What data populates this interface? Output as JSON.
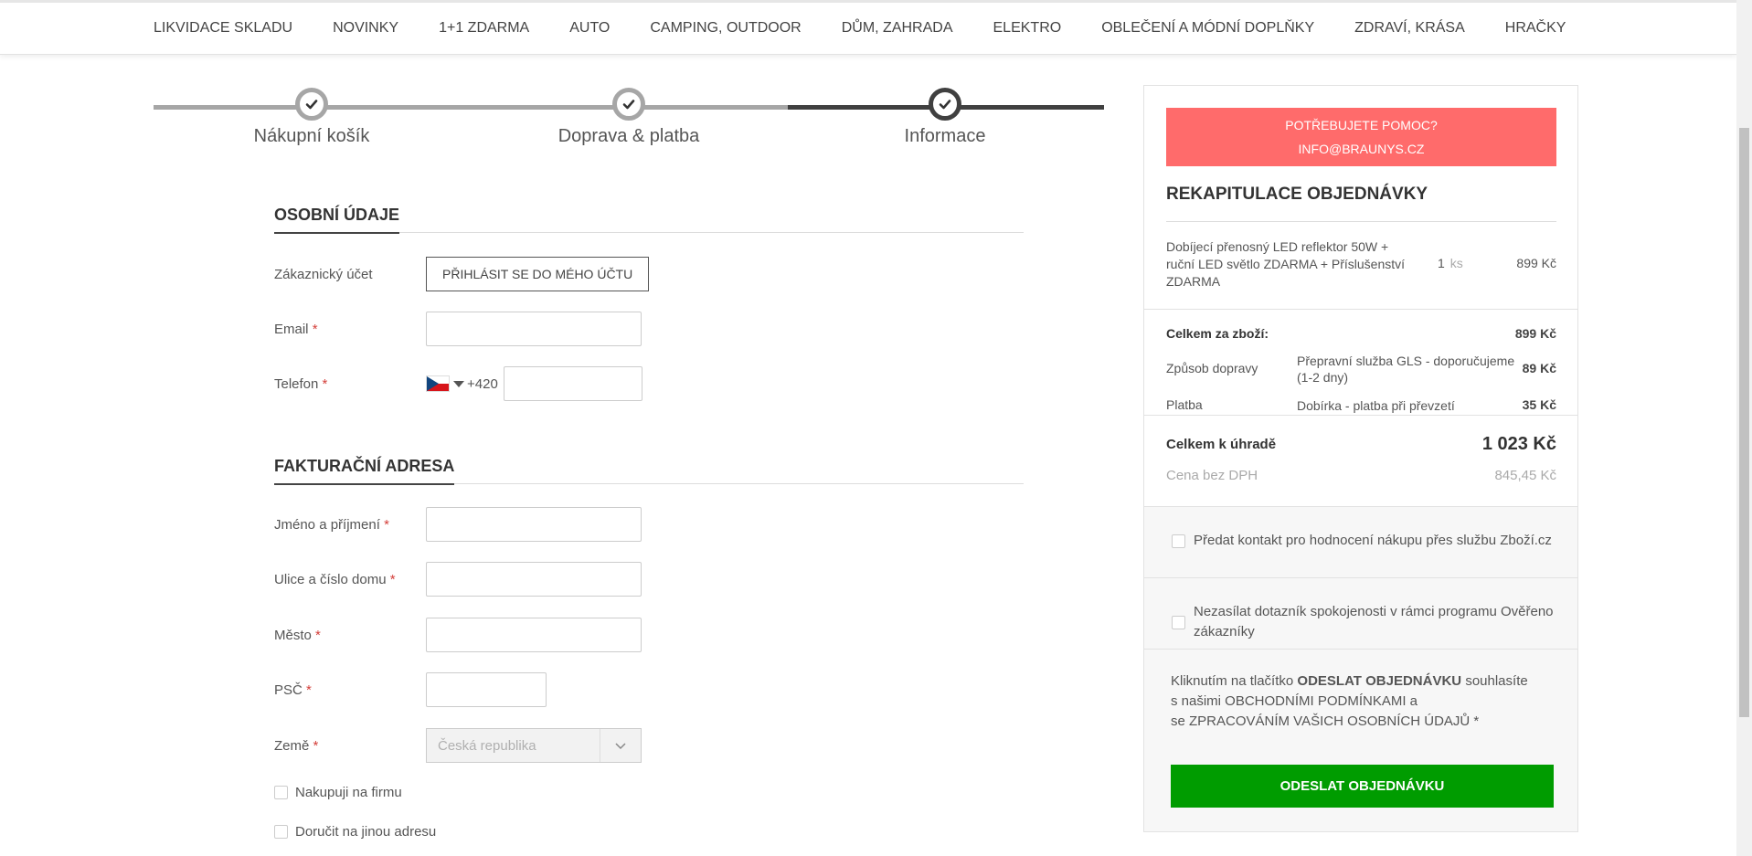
{
  "nav": {
    "items": [
      "LIKVIDACE SKLADU",
      "NOVINKY",
      "1+1 ZDARMA",
      "AUTO",
      "CAMPING, OUTDOOR",
      "DŮM, ZAHRADA",
      "ELEKTRO",
      "OBLEČENÍ A MÓDNÍ DOPLŇKY",
      "ZDRAVÍ, KRÁSA",
      "HRAČKY"
    ]
  },
  "steps": [
    {
      "label": "Nákupní košík",
      "state": "done"
    },
    {
      "label": "Doprava & platba",
      "state": "done"
    },
    {
      "label": "Informace",
      "state": "active"
    }
  ],
  "personal": {
    "title": "OSOBNÍ ÚDAJE",
    "account_label": "Zákaznický účet",
    "login_button": "PŘIHLÁSIT SE DO MÉHO ÚČTU",
    "email_label": "Email",
    "phone_label": "Telefon",
    "phone_prefix": "+420",
    "required_mark": "*"
  },
  "billing": {
    "title": "FAKTURAČNÍ ADRESA",
    "name_label": "Jméno a příjmení",
    "street_label": "Ulice a číslo domu",
    "city_label": "Město",
    "zip_label": "PSČ",
    "country_label": "Země",
    "country_value": "Česká republika",
    "company_checkbox": "Nakupuji na firmu",
    "other_address_checkbox": "Doručit na jinou adresu"
  },
  "sidebar": {
    "help_line1": "POTŘEBUJETE POMOC?",
    "help_line2": "INFO@BRAUNYS.CZ",
    "recap_title": "REKAPITULACE OBJEDNÁVKY",
    "item": {
      "name": "Dobíjecí přenosný LED reflektor 50W + ruční LED světlo ZDARMA + Příslušenství ZDARMA",
      "qty": "1",
      "unit": "ks",
      "price": "899 Kč"
    },
    "goods_total_label": "Celkem za zboží:",
    "goods_total_value": "899 Kč",
    "shipping_label": "Způsob dopravy",
    "shipping_method": "Přepravní služba GLS - doporučujeme (1-2 dny)",
    "shipping_price": "89 Kč",
    "payment_label": "Platba",
    "payment_method": "Dobírka - platba při převzetí",
    "payment_price": "35 Kč",
    "total_label": "Celkem k úhradě",
    "total_value": "1 023 Kč",
    "net_label": "Cena bez DPH",
    "net_value": "845,45 Kč",
    "consent1": "Předat kontakt pro hodnocení nákupu přes službu Zboží.cz",
    "consent2": "Nezasílat dotazník spokojenosti v rámci programu Ověřeno zákazníky",
    "terms_prefix": "Kliknutím na tlačítko ",
    "terms_bold": "ODESLAT OBJEDNÁVKU",
    "terms_suffix": " souhlasíte",
    "terms_line2": "s našimi OBCHODNÍMI PODMÍNKAMI a",
    "terms_line3": "se ZPRACOVÁNÍM VAŠICH OSOBNÍCH ÚDAJŮ *",
    "submit": "ODESLAT OBJEDNÁVKU"
  },
  "colors": {
    "help_bg": "#ff6b6b",
    "submit_bg": "#009c00",
    "required": "#d43f3a"
  }
}
